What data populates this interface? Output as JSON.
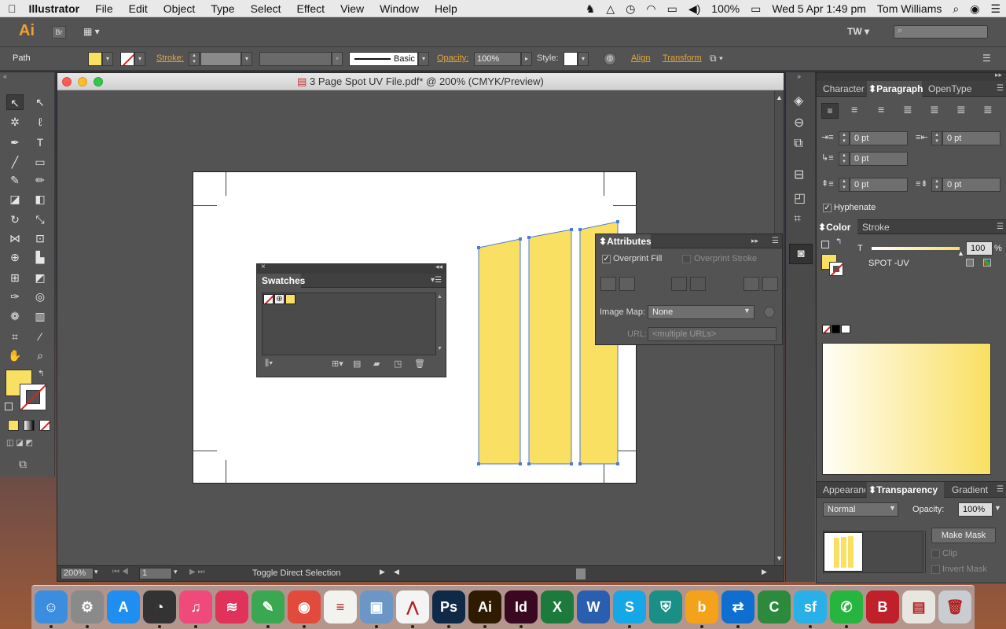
{
  "menubar": {
    "app_name": "Illustrator",
    "items": [
      "File",
      "Edit",
      "Object",
      "Type",
      "Select",
      "Effect",
      "View",
      "Window",
      "Help"
    ],
    "battery": "100%",
    "datetime": "Wed 5 Apr  1:49 pm",
    "user": "Tom Williams"
  },
  "appbar": {
    "logo": "Ai",
    "bridge": "Br",
    "workspace_initials": "TW"
  },
  "control": {
    "selection_type": "Path",
    "stroke_label": "Stroke:",
    "brush_label": "Basic",
    "opacity_label": "Opacity:",
    "opacity_value": "100%",
    "style_label": "Style:",
    "align_label": "Align",
    "transform_label": "Transform",
    "fill_color": "#f9df62"
  },
  "document": {
    "title": "3 Page Spot UV File.pdf* @ 200% (CMYK/Preview)",
    "zoom": "200%",
    "page": "1",
    "status_text": "Toggle Direct Selection"
  },
  "swatches_panel": {
    "title": "Swatches"
  },
  "attributes_panel": {
    "title": "Attributes",
    "overprint_fill": "Overprint Fill",
    "overprint_stroke": "Overprint Stroke",
    "image_map_label": "Image Map:",
    "image_map_value": "None",
    "url_label": "URL:",
    "url_value": "<multiple URLs>"
  },
  "paragraph_panel": {
    "tabs": [
      "Character",
      "Paragraph",
      "OpenType"
    ],
    "active_tab": "Paragraph",
    "left_indent": "0 pt",
    "right_indent": "0 pt",
    "first_line_indent": "0 pt",
    "space_before": "0 pt",
    "space_after": "0 pt",
    "hyphenate": "Hyphenate"
  },
  "color_panel": {
    "tabs": [
      "Color",
      "Stroke"
    ],
    "active_tab": "Color",
    "tint_label": "T",
    "tint_value": "100",
    "tint_unit": "%",
    "swatch_name": "SPOT -UV",
    "spot_color": "#f9df62"
  },
  "transparency_panel": {
    "tabs": [
      "Appearance",
      "Transparency",
      "Gradient"
    ],
    "active_tab": "Transparency",
    "blend_mode": "Normal",
    "opacity_label": "Opacity:",
    "opacity_value": "100%",
    "make_mask": "Make Mask",
    "clip": "Clip",
    "invert_mask": "Invert Mask"
  },
  "dock": {
    "apps": [
      {
        "label": "Finder",
        "color": "#3b8de0",
        "glyph": "☺"
      },
      {
        "label": "System Preferences",
        "color": "#8a8a8a",
        "glyph": "⚙"
      },
      {
        "label": "App Store",
        "color": "#1e8ef0",
        "glyph": "A"
      },
      {
        "label": "Dashboard",
        "color": "#333333",
        "glyph": "◔"
      },
      {
        "label": "iTunes",
        "color": "#f04a7a",
        "glyph": "♫"
      },
      {
        "label": "Lips",
        "color": "#e0325a",
        "glyph": "≋"
      },
      {
        "label": "Evernote",
        "color": "#3aa850",
        "glyph": "✎"
      },
      {
        "label": "Chrome",
        "color": "#e24b3b",
        "glyph": "◉"
      },
      {
        "label": "TextEdit",
        "color": "#f2f2ee",
        "glyph": "≡"
      },
      {
        "label": "Preview",
        "color": "#6b97c6",
        "glyph": "▣"
      },
      {
        "label": "Acrobat",
        "color": "#f4f4f4",
        "glyph": "⋀"
      },
      {
        "label": "Ps",
        "color": "#0f2a47",
        "glyph": "Ps"
      },
      {
        "label": "Ai",
        "color": "#2f1a02",
        "glyph": "Ai"
      },
      {
        "label": "Id",
        "color": "#3a0820",
        "glyph": "Id"
      },
      {
        "label": "Excel",
        "color": "#1b7a3c",
        "glyph": "X"
      },
      {
        "label": "Word",
        "color": "#2a5fb0",
        "glyph": "W"
      },
      {
        "label": "Skype",
        "color": "#16a7e6",
        "glyph": "S"
      },
      {
        "label": "Shield",
        "color": "#1a8f86",
        "glyph": "⛨"
      },
      {
        "label": "Behance",
        "color": "#f5a21b",
        "glyph": "b"
      },
      {
        "label": "TeamViewer",
        "color": "#0e6fd1",
        "glyph": "⇄"
      },
      {
        "label": "Camtasia",
        "color": "#2b8a3b",
        "glyph": "C"
      },
      {
        "label": "Salesforce",
        "color": "#2ab0e8",
        "glyph": "sf"
      },
      {
        "label": "WhatsApp",
        "color": "#26b53f",
        "glyph": "✆"
      },
      {
        "label": "Bitdefender",
        "color": "#c0202a",
        "glyph": "B"
      },
      {
        "label": "Documents",
        "color": "#e8e6e0",
        "glyph": "▤"
      },
      {
        "label": "Trash",
        "color": "#c9ccd1",
        "glyph": "🗑"
      }
    ]
  }
}
